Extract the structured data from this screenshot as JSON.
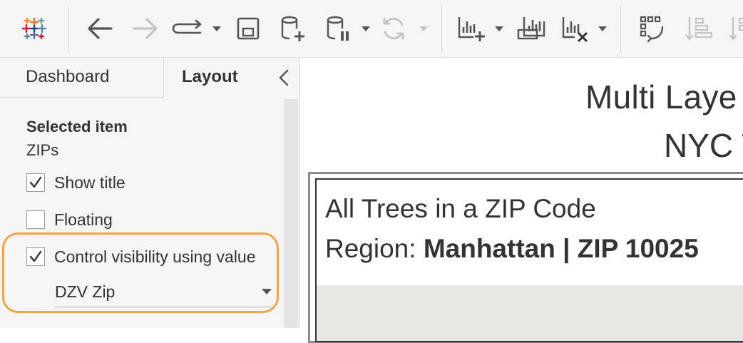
{
  "toolbar": {
    "icons": [
      "tableau-logo-icon",
      "back-arrow-icon",
      "forward-arrow-icon",
      "redo-icon",
      "dropdown-caret-icon",
      "save-icon",
      "new-datasource-icon",
      "pause-updates-icon",
      "dropdown-caret-icon",
      "refresh-icon",
      "dropdown-caret-icon",
      "new-worksheet-icon",
      "dropdown-caret-icon",
      "duplicate-sheet-icon",
      "clear-sheet-icon",
      "dropdown-caret-icon",
      "swap-rows-columns-icon",
      "sort-ascending-icon",
      "sort-descending-icon"
    ]
  },
  "sidebar": {
    "tabs": [
      {
        "label": "Dashboard"
      },
      {
        "label": "Layout"
      }
    ],
    "selected_item_heading": "Selected item",
    "selected_item_value": "ZIPs",
    "options": [
      {
        "label": "Show title",
        "checked": true
      },
      {
        "label": "Floating",
        "checked": false
      },
      {
        "label": "Control visibility using value",
        "checked": true
      }
    ],
    "visibility_dropdown": {
      "value": "DZV Zip"
    }
  },
  "dashboard": {
    "title_line1": "Multi Laye",
    "title_line2": "NYC T",
    "worksheet_title": "All Trees in a ZIP Code",
    "region_label": "Region: ",
    "region_value": "Manhattan | ZIP 10025"
  },
  "colors": {
    "highlight": "#f0a54a",
    "toolbar_bg": "#f5f5f5",
    "icon_gray": "#555555",
    "icon_disabled": "#c4c4c4"
  }
}
